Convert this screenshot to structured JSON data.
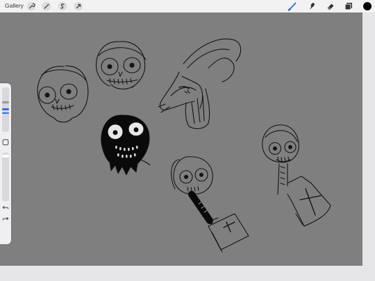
{
  "topbar": {
    "gallery_label": "Gallery",
    "left_icons": [
      "wrench-icon",
      "magic-wand-icon",
      "selection-s-icon",
      "transform-arrow-icon"
    ],
    "right_icons": [
      "brush-icon",
      "smudge-icon",
      "eraser-icon",
      "layers-icon",
      "color-swatch-icon"
    ]
  },
  "sidebar": {
    "buttons": [
      "square-modify-icon",
      "undo-icon",
      "redo-icon"
    ]
  },
  "colors": {
    "canvas": "#7f7f7f",
    "chrome": "#f2f2f3",
    "accent": "#2f6fd6",
    "current_color": "#000000",
    "ink": "#111111"
  }
}
